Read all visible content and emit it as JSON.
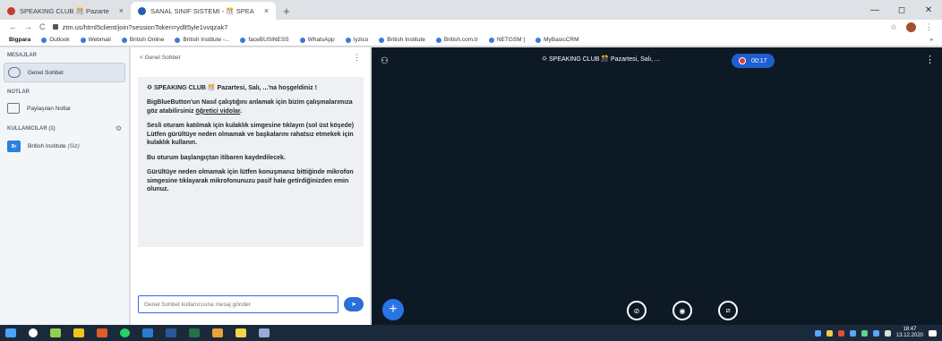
{
  "browser": {
    "tabs": [
      {
        "label": "SPEAKING CLUB 🎊 Pazarte",
        "active": false
      },
      {
        "label": "SANAL SINIF SISTEMI - 🎊 SPEA",
        "active": true
      }
    ],
    "new_tab": "+",
    "close": "×",
    "url": "ztm.us/html5client/join?sessionToken=ydlt5yle1vvqzak7",
    "window_controls": {
      "minimize": "—",
      "restore": "◻",
      "close": "✕"
    },
    "bookmarks": [
      "Bigpara",
      "Outlook",
      "Webmail",
      "British Online",
      "British Institute -...",
      "faceBUSINESS",
      "WhatsApp",
      "Iyzico",
      "British Institute",
      "British.com.tr",
      "NETGSM |",
      "MyBasicCRM"
    ],
    "bookmark_overflow": "»"
  },
  "sidebar": {
    "messages_title": "MESAJLAR",
    "public_chat": "Genel Sohbet",
    "notes_title": "NOTLAR",
    "shared_notes": "Paylaşılan Notlar",
    "users_title": "KULLANICILAR (1)",
    "user": {
      "initials": "Br",
      "name": "British Institute",
      "suffix": "(Siz)"
    }
  },
  "chat": {
    "back_label": "< Genel Sohbet",
    "menu": "⋮",
    "message": {
      "welcome": "🌣 SPEAKING CLUB 🎊 Pazartesi, Salı, ...'na hoşgeldiniz !",
      "p1_before": "BigBlueButton'un Nasıl çalıştığını anlamak için bizim çalışmalarımıza göz atabilirsiniz ",
      "p1_link": "öğretici vidolar",
      "p1_after": ".",
      "p2": "Sesli oturam katılmak için kulaklık simgesine tıklayın (sol üst köşede) Lütfen gürültüye neden olmamak ve başkalarını rahatsız etmekek için kulaklık kullanın.",
      "p3": "Bu oturum başlangıçtan itibaren kaydedilecek.",
      "p4": "Gürültüye neden olmamak için lütfen konuşmanız bittiğinde mikrofon simgesine tıklayarak mikrofonunuzu pasif hale getirdiğinizden emin olunuz."
    },
    "input_placeholder": "Genel Sohbet kullanıcısına mesaj gönder",
    "send_icon": "➤"
  },
  "stage": {
    "title": "🌣 SPEAKING CLUB 🎊 Pazartesi, Salı, ...",
    "recording_time": "00:17",
    "menu": "⋮",
    "plus": "+",
    "controls": [
      "⊘",
      "◉",
      "⧄"
    ]
  },
  "taskbar": {
    "time": "18:47",
    "date": "13.12.2020"
  },
  "colors": {
    "accent": "#2a6fd6",
    "stage_bg": "#0d1a26",
    "taskbar_bg": "#1b2a3a"
  }
}
